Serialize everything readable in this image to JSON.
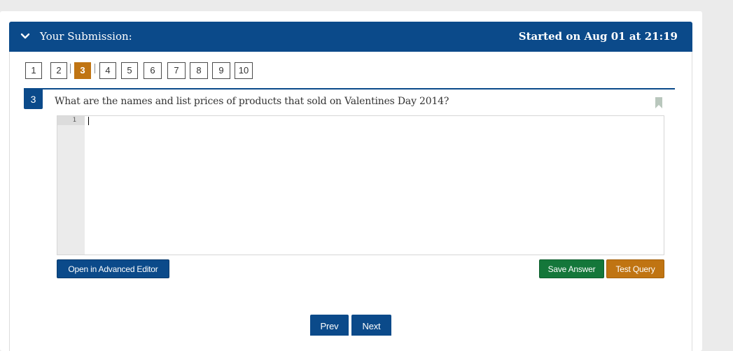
{
  "header": {
    "title": "Your Submission:",
    "started": "Started on Aug 01 at 21:19"
  },
  "pager": {
    "pages": [
      "1",
      "2",
      "3",
      "4",
      "5",
      "6",
      "7",
      "8",
      "9",
      "10"
    ],
    "active": "3"
  },
  "question": {
    "number": "3",
    "text": "What are the names and list prices of products that sold on Valentines Day 2014?"
  },
  "editor": {
    "line_number": "1",
    "content": ""
  },
  "buttons": {
    "advanced_editor": "Open in Advanced Editor",
    "save_answer": "Save Answer",
    "test_query": "Test Query",
    "prev": "Prev",
    "next": "Next"
  },
  "colors": {
    "primary": "#0b4a8a",
    "accent": "#c07412",
    "success": "#14773a"
  },
  "icons": {
    "header_toggle": "chevron-down-icon",
    "bookmark": "bookmark-icon"
  }
}
